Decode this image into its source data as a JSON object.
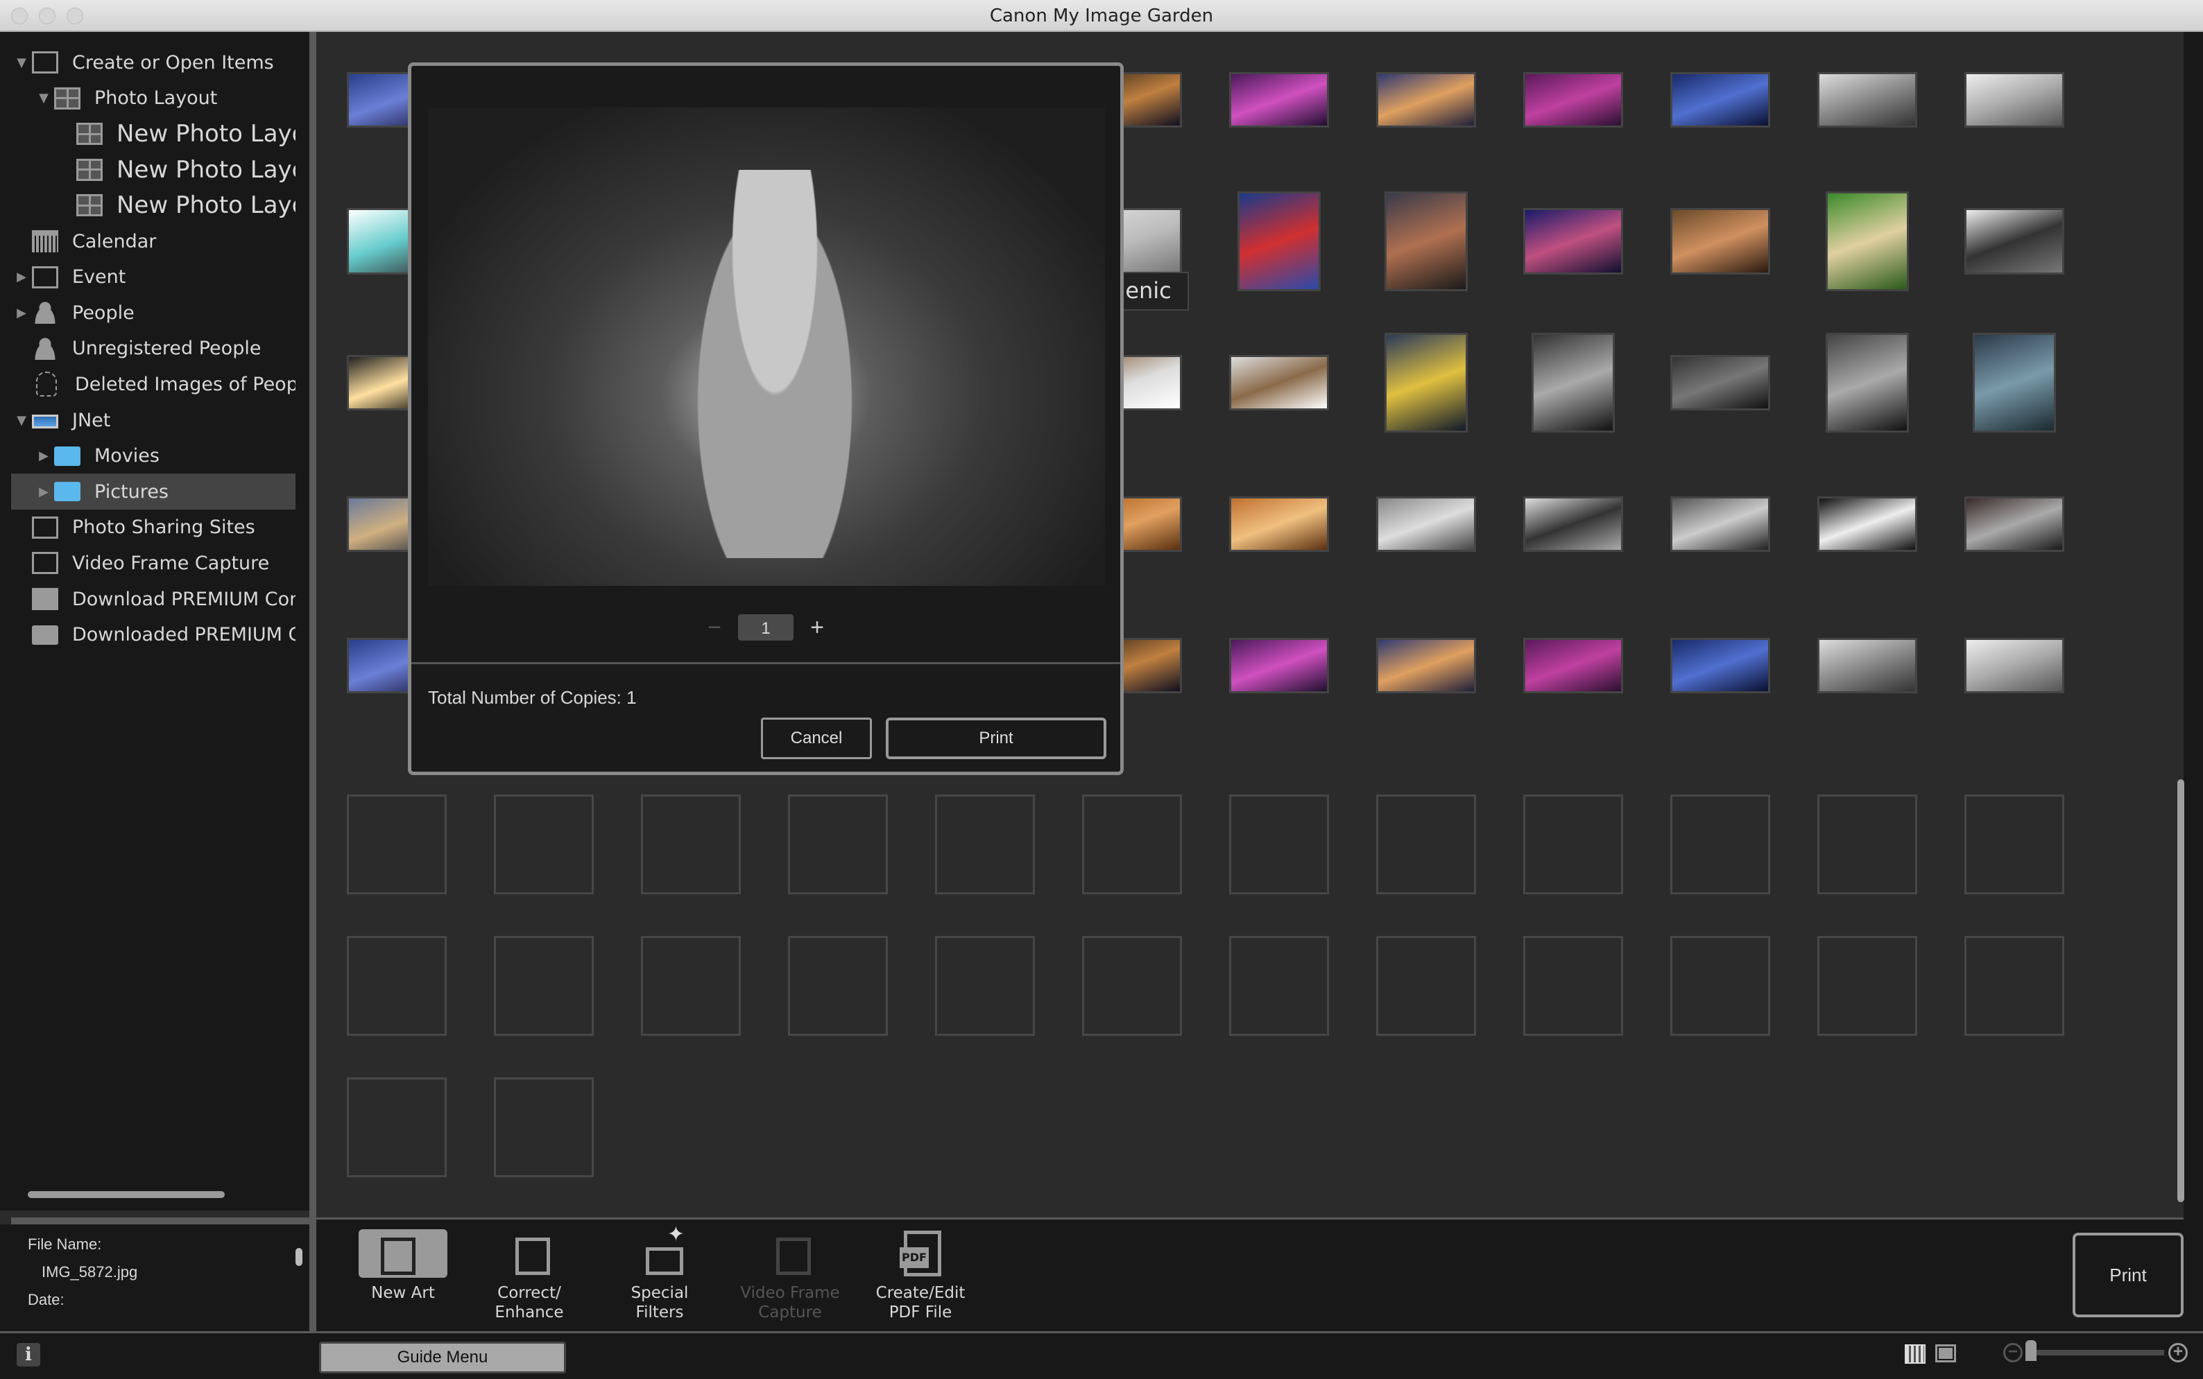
{
  "window": {
    "title": "Canon My Image Garden"
  },
  "sidebar": {
    "items": [
      {
        "label": "Create or Open Items",
        "icon": "create-icon",
        "arrow": "expanded"
      },
      {
        "label": "Photo Layout",
        "icon": "photo-layout-icon",
        "arrow": "expanded"
      },
      {
        "label": "New Photo Layout",
        "icon": "photo-layout-icon"
      },
      {
        "label": "New Photo Layout",
        "icon": "photo-layout-icon"
      },
      {
        "label": "New Photo Layout",
        "icon": "photo-layout-icon"
      },
      {
        "label": "Calendar",
        "icon": "calendar-icon"
      },
      {
        "label": "Event",
        "icon": "event-icon",
        "arrow": "collapsed"
      },
      {
        "label": "People",
        "icon": "person-icon",
        "arrow": "collapsed"
      },
      {
        "label": "Unregistered People",
        "icon": "unregistered-person-icon"
      },
      {
        "label": "Deleted Images of People",
        "icon": "deleted-person-icon"
      },
      {
        "label": "JNet",
        "icon": "laptop-icon",
        "arrow": "expanded"
      },
      {
        "label": "Movies",
        "icon": "movies-folder-icon",
        "arrow": "collapsed"
      },
      {
        "label": "Pictures",
        "icon": "pictures-folder-icon",
        "arrow": "collapsed",
        "selected": true
      },
      {
        "label": "Photo Sharing Sites",
        "icon": "photo-sharing-icon"
      },
      {
        "label": "Video Frame Capture",
        "icon": "video-frame-icon"
      },
      {
        "label": "Download PREMIUM Contents",
        "icon": "premium-icon"
      },
      {
        "label": "Downloaded PREMIUM Contents",
        "icon": "folder-icon"
      }
    ]
  },
  "info_panel": {
    "file_name_label": "File Name:",
    "file_name_value": "IMG_5872.jpg",
    "date_label": "Date:"
  },
  "dialog": {
    "copies_value": "1",
    "minus_label": "−",
    "plus_label": "+",
    "total_copies_text": "Total Number of Copies: 1",
    "cancel_label": "Cancel",
    "print_label": "Print"
  },
  "grid": {
    "partial_text": "genic",
    "filled_rows": 5,
    "empty_slots": 26,
    "columns": 12
  },
  "toolbar": {
    "tools": [
      {
        "label": "New Art",
        "enabled": true
      },
      {
        "label": "Correct/\nEnhance",
        "enabled": true
      },
      {
        "label": "Special\nFilters",
        "enabled": true
      },
      {
        "label": "Video Frame\nCapture",
        "enabled": false
      },
      {
        "label": "Create/Edit\nPDF File",
        "enabled": true
      }
    ],
    "print_label": "Print"
  },
  "statusbar": {
    "info_label": "i",
    "guide_menu_label": "Guide Menu",
    "zoom_level": 0.0
  }
}
